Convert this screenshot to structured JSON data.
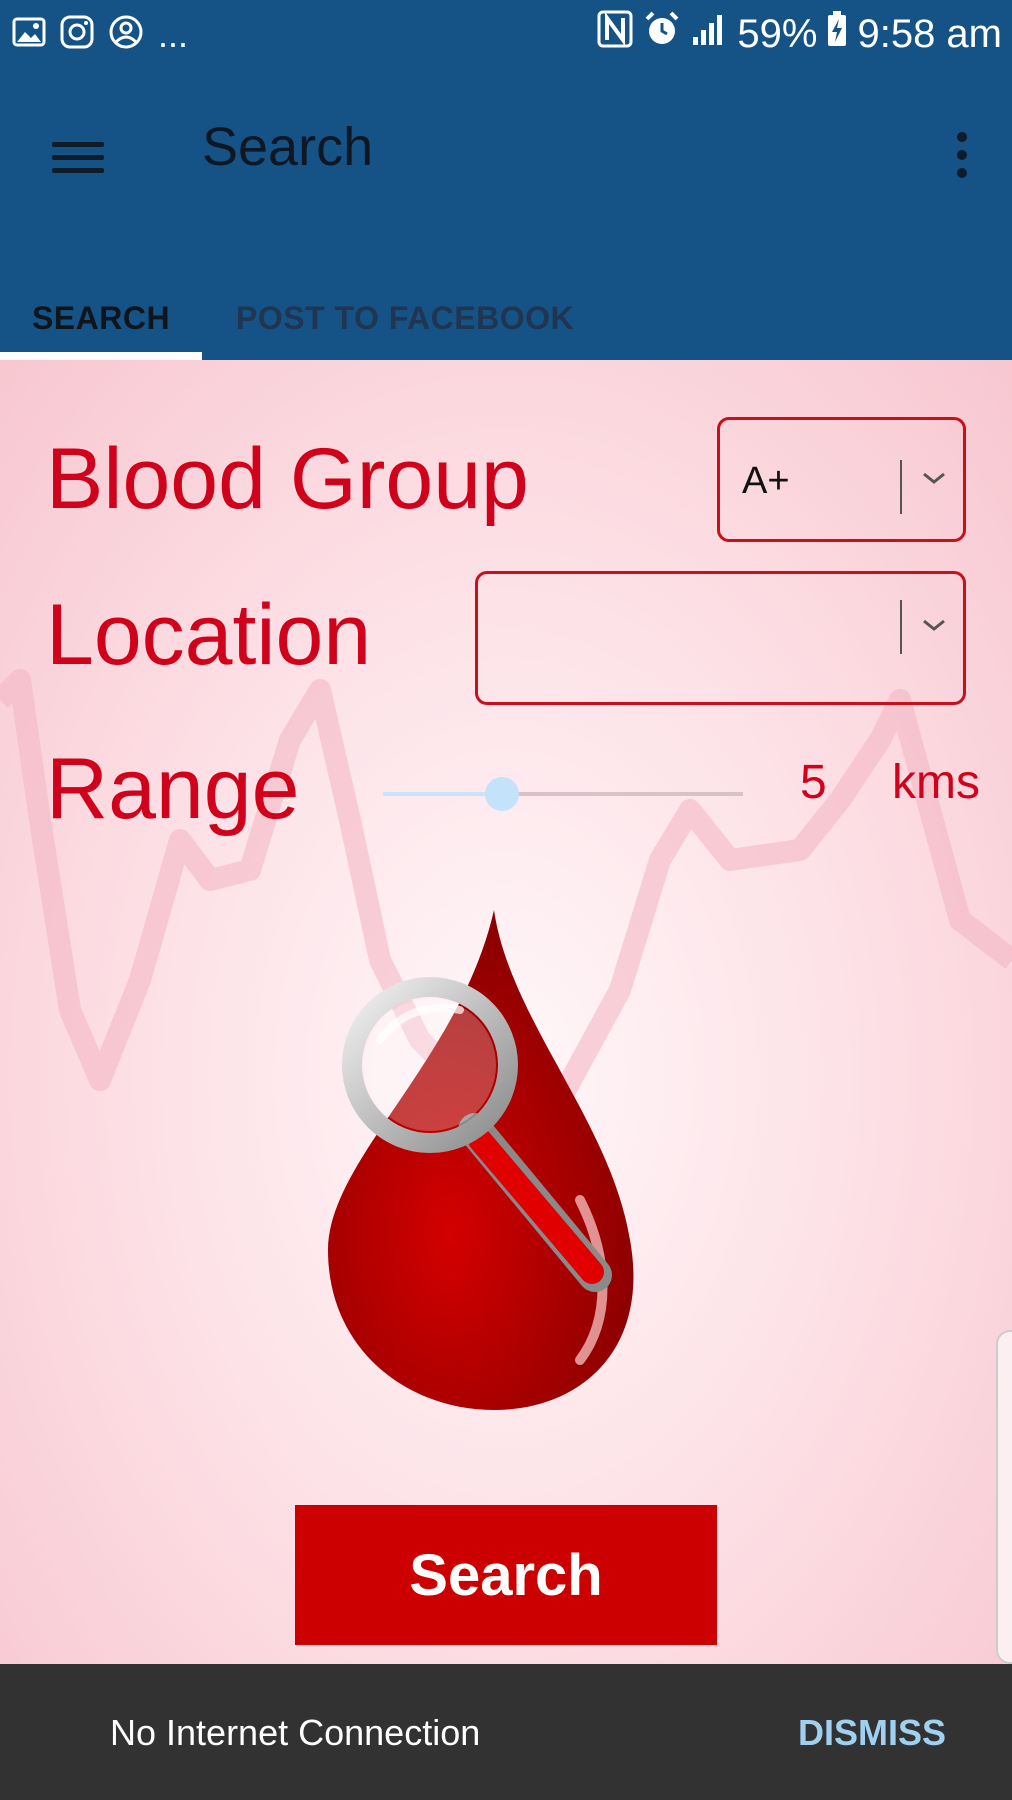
{
  "status_bar": {
    "icons_left": [
      "gallery-icon",
      "instagram-icon",
      "account-icon"
    ],
    "more": "...",
    "icons_right": [
      "nfc-icon",
      "alarm-icon",
      "signal-icon"
    ],
    "battery": "59%",
    "time": "9:58 am"
  },
  "app_bar": {
    "title": "Search",
    "menu_icon": "hamburger-icon",
    "overflow_icon": "more-vert-icon",
    "background": "#155387"
  },
  "tabs": [
    {
      "label": "SEARCH",
      "selected": true
    },
    {
      "label": "POST TO FACEBOOK",
      "selected": false
    }
  ],
  "form": {
    "blood_group_label": "Blood Group",
    "blood_group_value": "A+",
    "location_label": "Location",
    "location_value": "",
    "range_label": "Range",
    "range_value": "5",
    "range_unit": "kms",
    "range_slider_fraction": 0.33,
    "accent_color": "#d0021b"
  },
  "illustration": "blood-drop-magnifier-icon",
  "search_button": {
    "label": "Search",
    "color": "#cc0000"
  },
  "snackbar": {
    "message": "No Internet Connection",
    "action": "DISMISS"
  }
}
